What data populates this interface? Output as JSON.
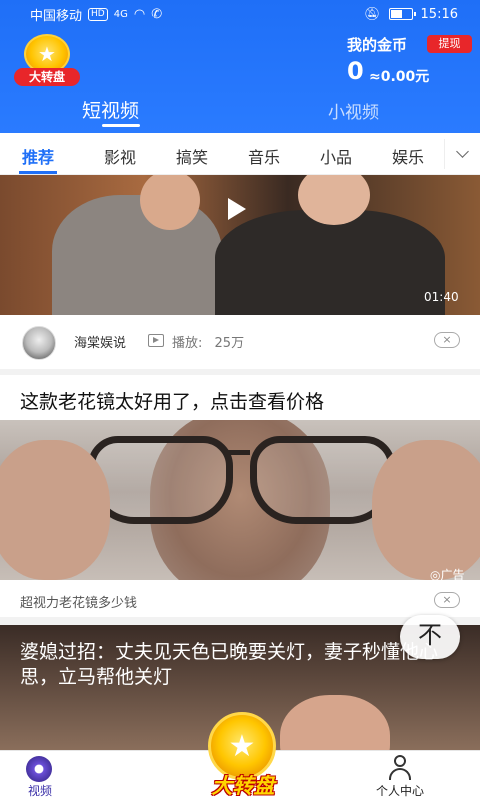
{
  "status_bar": {
    "carrier": "中国移动",
    "hd": "HD",
    "signal": "4G",
    "time": "15:16",
    "battery_level": 0.6
  },
  "header": {
    "wheel_badge_label": "大转盘",
    "coins_title": "我的金币",
    "withdraw_label": "提现",
    "coin_value": "0",
    "coin_money": "≈0.00元",
    "tabs": [
      {
        "label": "短视频",
        "active": true
      },
      {
        "label": "小视频",
        "active": false
      }
    ]
  },
  "categories": [
    {
      "label": "推荐",
      "active": true
    },
    {
      "label": "影视"
    },
    {
      "label": "搞笑"
    },
    {
      "label": "音乐"
    },
    {
      "label": "小品"
    },
    {
      "label": "娱乐"
    }
  ],
  "feed": {
    "video": {
      "duration": "01:40",
      "author": "海棠娱说",
      "plays_label": "播放:",
      "plays_value": "25万",
      "close": "×"
    },
    "ad": {
      "title": "这款老花镜太好用了，点击查看价格",
      "tag": "◎广告",
      "description": "超视力老花镜多少钱",
      "close": "×"
    },
    "news2": {
      "title": "婆媳过招：丈夫见天色已晚要关灯，妻子秒懂他心思，立马帮他关灯"
    },
    "back_to_top": "不"
  },
  "bottom_nav": {
    "video_label": "视频",
    "center_label": "大转盘",
    "profile_label": "个人中心"
  },
  "colors": {
    "brand_blue": "#1f6ff7",
    "accent_red": "#e8262a",
    "gold": "#ffc400"
  }
}
